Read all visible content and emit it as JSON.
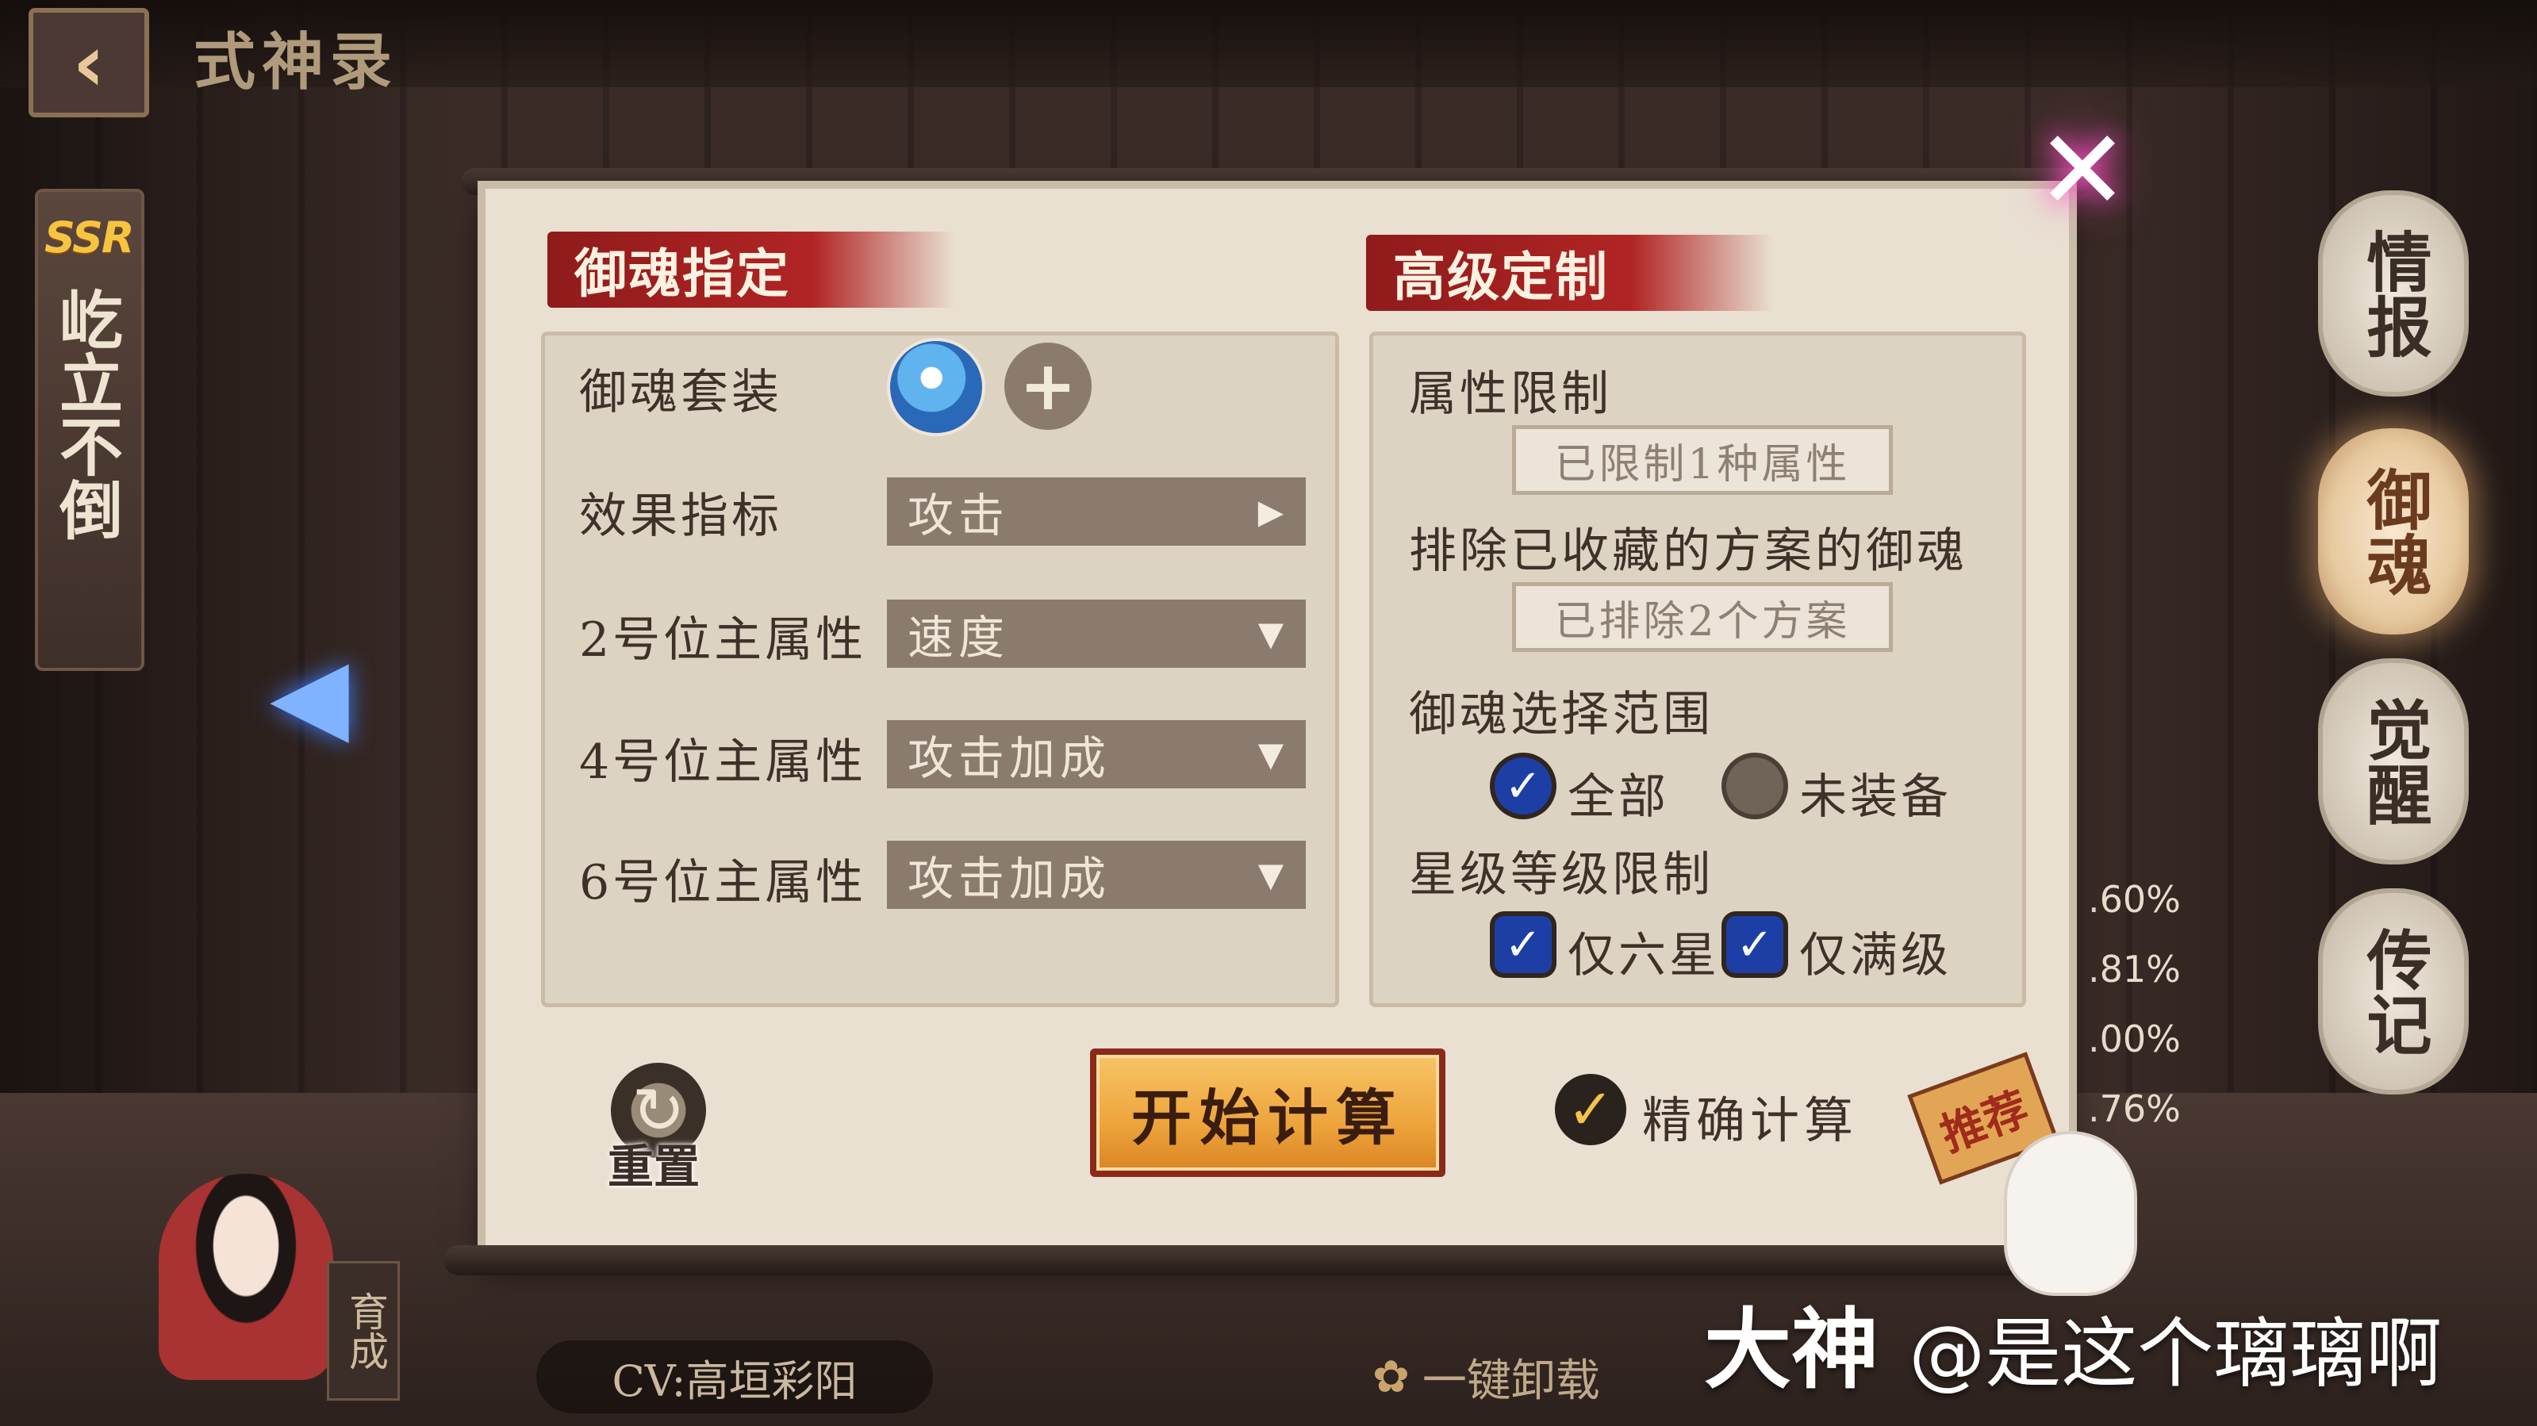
{
  "header": {
    "back_icon": "back-arrow-icon",
    "title": "式神录"
  },
  "character": {
    "rarity": "SSR",
    "name": "屹立不倒"
  },
  "right_tabs": [
    "情报",
    "御魂",
    "觉醒",
    "传记"
  ],
  "side_percents": [
    ".60%",
    ".81%",
    ".00%",
    ".76%"
  ],
  "left_section": {
    "title": "御魂指定",
    "rows": [
      {
        "label": "御魂套装"
      },
      {
        "label": "效果指标",
        "value": "攻击",
        "icon": "caret-right-icon"
      },
      {
        "label": "2号位主属性",
        "value": "速度",
        "icon": "caret-down-icon"
      },
      {
        "label": "4号位主属性",
        "value": "攻击加成",
        "icon": "caret-down-icon"
      },
      {
        "label": "6号位主属性",
        "value": "攻击加成",
        "icon": "caret-down-icon"
      }
    ]
  },
  "right_section": {
    "title": "高级定制",
    "attr_limit_label": "属性限制",
    "attr_limit_button": "已限制1种属性",
    "exclude_label": "排除已收藏的方案的御魂",
    "exclude_button": "已排除2个方案",
    "range_label": "御魂选择范围",
    "range_all": "全部",
    "range_unequipped": "未装备",
    "star_label": "星级等级限制",
    "only_six_star": "仅六星",
    "only_max_level": "仅满级"
  },
  "actions": {
    "reset": "重置",
    "start": "开始计算",
    "precise": "精确计算",
    "recommend": "推荐"
  },
  "footer": {
    "nurture": "育成",
    "cv": "CV:高垣彩阳",
    "one_click_unload": "一键卸载"
  },
  "watermark": {
    "brand": "大神",
    "handle": "@是这个璃璃啊"
  },
  "colors": {
    "accent_red": "#b12424",
    "start_orange": "#eea43c",
    "check_blue": "#1d3fa5",
    "panel": "#e9e0d2"
  }
}
